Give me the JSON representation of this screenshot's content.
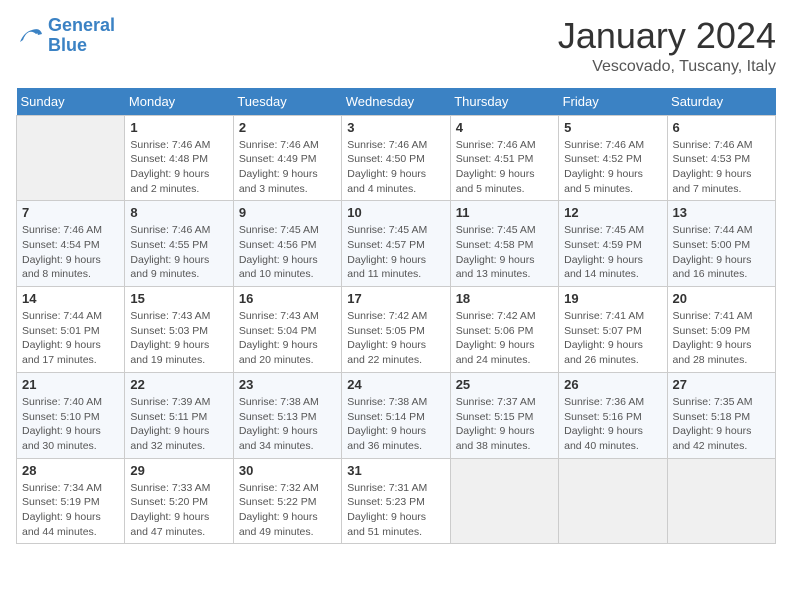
{
  "header": {
    "logo_line1": "General",
    "logo_line2": "Blue",
    "month": "January 2024",
    "location": "Vescovado, Tuscany, Italy"
  },
  "weekdays": [
    "Sunday",
    "Monday",
    "Tuesday",
    "Wednesday",
    "Thursday",
    "Friday",
    "Saturday"
  ],
  "weeks": [
    [
      {
        "day": "",
        "info": ""
      },
      {
        "day": "1",
        "info": "Sunrise: 7:46 AM\nSunset: 4:48 PM\nDaylight: 9 hours\nand 2 minutes."
      },
      {
        "day": "2",
        "info": "Sunrise: 7:46 AM\nSunset: 4:49 PM\nDaylight: 9 hours\nand 3 minutes."
      },
      {
        "day": "3",
        "info": "Sunrise: 7:46 AM\nSunset: 4:50 PM\nDaylight: 9 hours\nand 4 minutes."
      },
      {
        "day": "4",
        "info": "Sunrise: 7:46 AM\nSunset: 4:51 PM\nDaylight: 9 hours\nand 5 minutes."
      },
      {
        "day": "5",
        "info": "Sunrise: 7:46 AM\nSunset: 4:52 PM\nDaylight: 9 hours\nand 5 minutes."
      },
      {
        "day": "6",
        "info": "Sunrise: 7:46 AM\nSunset: 4:53 PM\nDaylight: 9 hours\nand 7 minutes."
      }
    ],
    [
      {
        "day": "7",
        "info": "Sunrise: 7:46 AM\nSunset: 4:54 PM\nDaylight: 9 hours\nand 8 minutes."
      },
      {
        "day": "8",
        "info": "Sunrise: 7:46 AM\nSunset: 4:55 PM\nDaylight: 9 hours\nand 9 minutes."
      },
      {
        "day": "9",
        "info": "Sunrise: 7:45 AM\nSunset: 4:56 PM\nDaylight: 9 hours\nand 10 minutes."
      },
      {
        "day": "10",
        "info": "Sunrise: 7:45 AM\nSunset: 4:57 PM\nDaylight: 9 hours\nand 11 minutes."
      },
      {
        "day": "11",
        "info": "Sunrise: 7:45 AM\nSunset: 4:58 PM\nDaylight: 9 hours\nand 13 minutes."
      },
      {
        "day": "12",
        "info": "Sunrise: 7:45 AM\nSunset: 4:59 PM\nDaylight: 9 hours\nand 14 minutes."
      },
      {
        "day": "13",
        "info": "Sunrise: 7:44 AM\nSunset: 5:00 PM\nDaylight: 9 hours\nand 16 minutes."
      }
    ],
    [
      {
        "day": "14",
        "info": "Sunrise: 7:44 AM\nSunset: 5:01 PM\nDaylight: 9 hours\nand 17 minutes."
      },
      {
        "day": "15",
        "info": "Sunrise: 7:43 AM\nSunset: 5:03 PM\nDaylight: 9 hours\nand 19 minutes."
      },
      {
        "day": "16",
        "info": "Sunrise: 7:43 AM\nSunset: 5:04 PM\nDaylight: 9 hours\nand 20 minutes."
      },
      {
        "day": "17",
        "info": "Sunrise: 7:42 AM\nSunset: 5:05 PM\nDaylight: 9 hours\nand 22 minutes."
      },
      {
        "day": "18",
        "info": "Sunrise: 7:42 AM\nSunset: 5:06 PM\nDaylight: 9 hours\nand 24 minutes."
      },
      {
        "day": "19",
        "info": "Sunrise: 7:41 AM\nSunset: 5:07 PM\nDaylight: 9 hours\nand 26 minutes."
      },
      {
        "day": "20",
        "info": "Sunrise: 7:41 AM\nSunset: 5:09 PM\nDaylight: 9 hours\nand 28 minutes."
      }
    ],
    [
      {
        "day": "21",
        "info": "Sunrise: 7:40 AM\nSunset: 5:10 PM\nDaylight: 9 hours\nand 30 minutes."
      },
      {
        "day": "22",
        "info": "Sunrise: 7:39 AM\nSunset: 5:11 PM\nDaylight: 9 hours\nand 32 minutes."
      },
      {
        "day": "23",
        "info": "Sunrise: 7:38 AM\nSunset: 5:13 PM\nDaylight: 9 hours\nand 34 minutes."
      },
      {
        "day": "24",
        "info": "Sunrise: 7:38 AM\nSunset: 5:14 PM\nDaylight: 9 hours\nand 36 minutes."
      },
      {
        "day": "25",
        "info": "Sunrise: 7:37 AM\nSunset: 5:15 PM\nDaylight: 9 hours\nand 38 minutes."
      },
      {
        "day": "26",
        "info": "Sunrise: 7:36 AM\nSunset: 5:16 PM\nDaylight: 9 hours\nand 40 minutes."
      },
      {
        "day": "27",
        "info": "Sunrise: 7:35 AM\nSunset: 5:18 PM\nDaylight: 9 hours\nand 42 minutes."
      }
    ],
    [
      {
        "day": "28",
        "info": "Sunrise: 7:34 AM\nSunset: 5:19 PM\nDaylight: 9 hours\nand 44 minutes."
      },
      {
        "day": "29",
        "info": "Sunrise: 7:33 AM\nSunset: 5:20 PM\nDaylight: 9 hours\nand 47 minutes."
      },
      {
        "day": "30",
        "info": "Sunrise: 7:32 AM\nSunset: 5:22 PM\nDaylight: 9 hours\nand 49 minutes."
      },
      {
        "day": "31",
        "info": "Sunrise: 7:31 AM\nSunset: 5:23 PM\nDaylight: 9 hours\nand 51 minutes."
      },
      {
        "day": "",
        "info": ""
      },
      {
        "day": "",
        "info": ""
      },
      {
        "day": "",
        "info": ""
      }
    ]
  ]
}
